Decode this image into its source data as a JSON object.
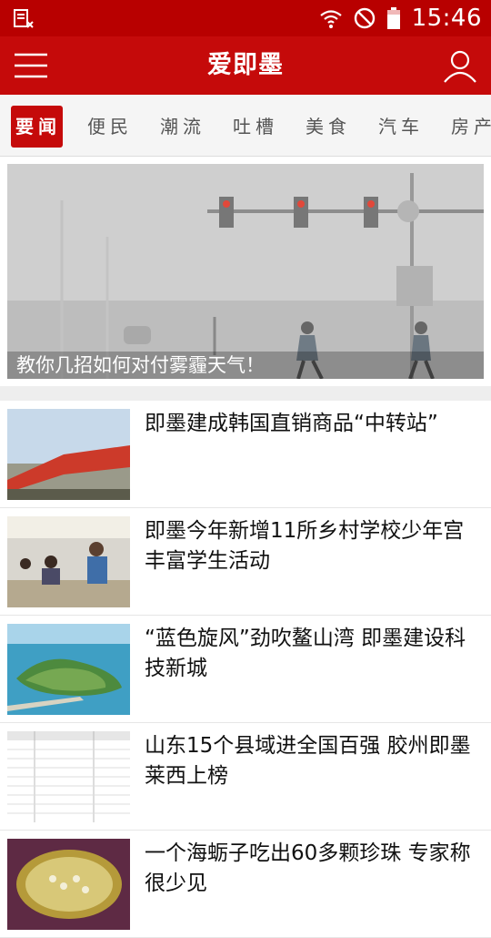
{
  "status_bar": {
    "time": "15:46",
    "icons": [
      "reading-mode-icon",
      "wifi-icon",
      "do-not-disturb-icon",
      "battery-icon"
    ]
  },
  "app_bar": {
    "title": "爱即墨",
    "icons": [
      "menu-icon",
      "user-icon"
    ]
  },
  "tabs": [
    {
      "label": "要闻",
      "active": true
    },
    {
      "label": "便民",
      "active": false
    },
    {
      "label": "潮流",
      "active": false
    },
    {
      "label": "吐槽",
      "active": false
    },
    {
      "label": "美食",
      "active": false
    },
    {
      "label": "汽车",
      "active": false
    },
    {
      "label": "房产",
      "active": false
    }
  ],
  "featured": {
    "caption": "教你几招如何对付雾霾天气！"
  },
  "news": [
    {
      "title": "即墨建成韩国直销商品“中转站”"
    },
    {
      "title": "即墨今年新增11所乡村学校少年宫 丰富学生活动"
    },
    {
      "title": "“蓝色旋风”劲吹鳌山湾 即墨建设科技新城"
    },
    {
      "title": "山东15个县域进全国百强 胶州即墨莱西上榜"
    },
    {
      "title": "一个海蛎子吃出60多颗珍珠 专家称很少见"
    }
  ],
  "colors": {
    "brand_red": "#c50a0a",
    "status_red": "#b80000",
    "tab_bg": "#f5f5f5"
  }
}
